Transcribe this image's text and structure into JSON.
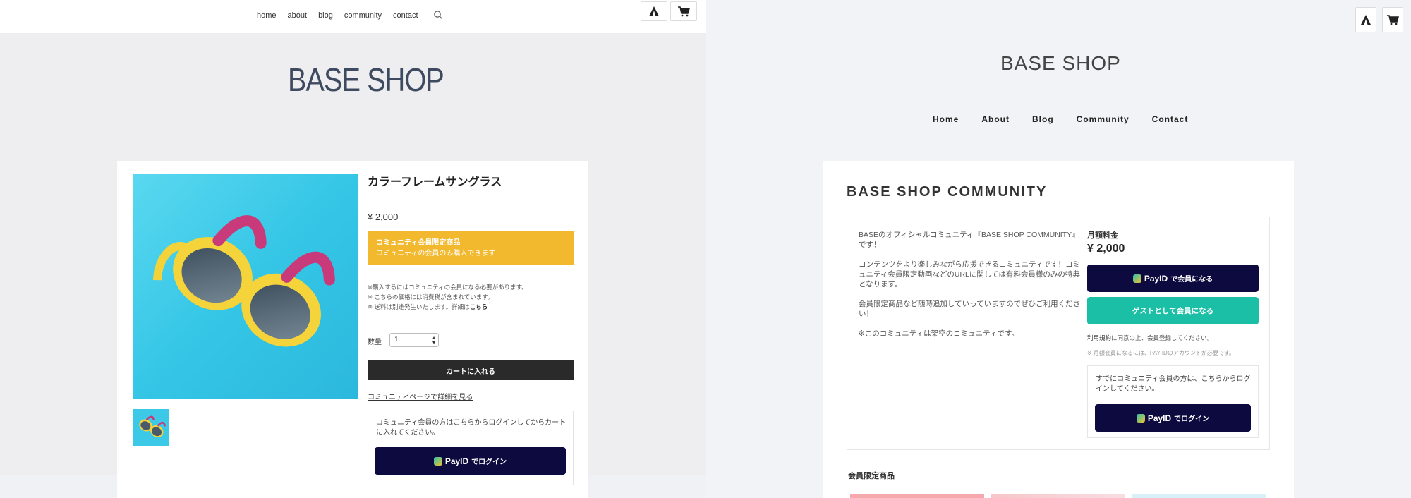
{
  "left": {
    "nav": [
      "home",
      "about",
      "blog",
      "community",
      "contact"
    ],
    "icons": {
      "search": "search-icon",
      "tent": "tent-icon",
      "cart": "cart-icon"
    },
    "shop_name": "BASE SHOP",
    "product": {
      "title": "カラーフレームサングラス",
      "price": "¥ 2,000",
      "member_badge_title": "コミュニティ会員限定商品",
      "member_badge_sub": "コミュニティの会員のみ購入できます",
      "notes": [
        "※購入するにはコミュニティの会員になる必要があります。",
        "※ こちらの価格には消費税が含まれています。",
        "※ 送料は別途発生いたします。詳細は"
      ],
      "notes_link": "こちら",
      "qty_label": "数量",
      "qty_value": "1",
      "cart_button": "カートに入れる",
      "community_link": "コミュニティページで詳細を見る",
      "login_text": "コミュニティ会員の方はこちらからログインしてからカートに入れてください。",
      "payid_brand": "PayID",
      "payid_login": "でログイン"
    }
  },
  "right": {
    "shop_name": "BASE SHOP",
    "nav": [
      "Home",
      "About",
      "Blog",
      "Community",
      "Contact"
    ],
    "community_title": "BASE SHOP COMMUNITY",
    "description": [
      "BASEのオフィシャルコミュニティ『BASE SHOP COMMUNITY』です！",
      "コンテンツをより楽しみながら応援できるコミュニティです！コミュニティ会員限定動画などのURLに関しては有料会員様のみの特典となります。",
      "会員限定商品など随時追加していっていますのでぜひご利用ください！",
      "※このコミュニティは架空のコミュニティです。"
    ],
    "fee_label": "月額料金",
    "fee_value": "¥ 2,000",
    "payid_brand": "PayID",
    "payid_member": "で会員になる",
    "guest_button": "ゲストとして会員になる",
    "terms_link": "利用規約",
    "terms_text": "に同意の上、会員登録してください。",
    "payid_note": "※ 月額会員になるには、PAY IDのアカウントが必要です。",
    "login_text": "すでにコミュニティ会員の方は、こちらからログインしてください。",
    "payid_login": "でログイン",
    "members_products": "会員限定商品"
  }
}
